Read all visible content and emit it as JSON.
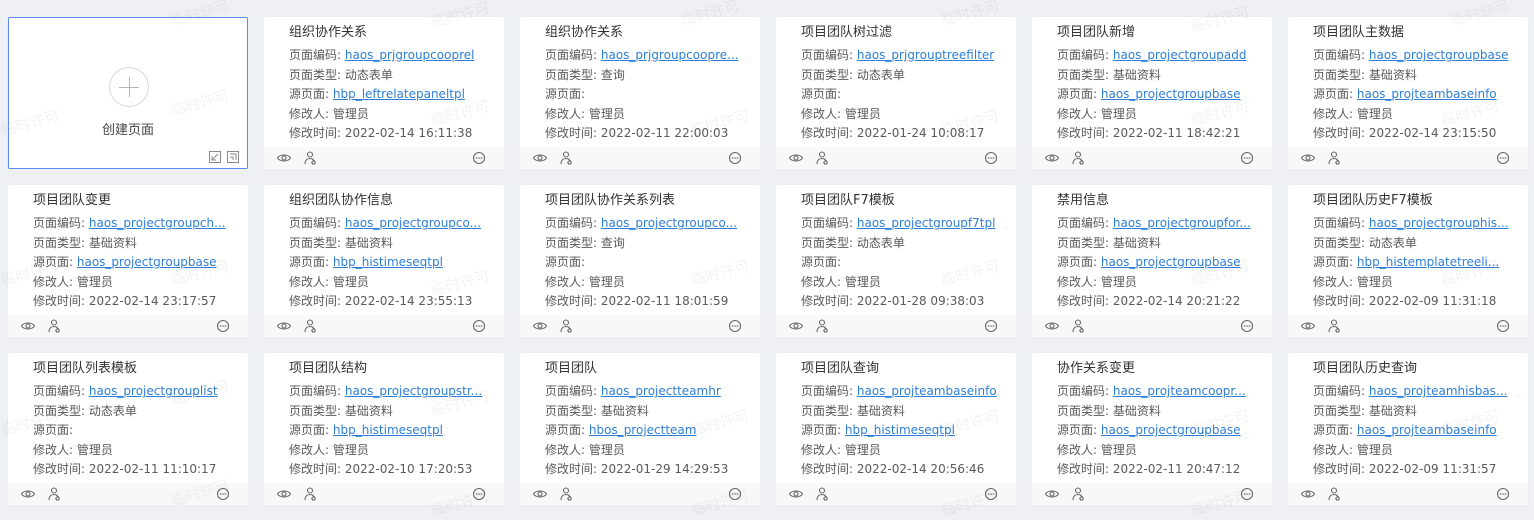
{
  "create_card": {
    "label": "创建页面"
  },
  "field_labels": {
    "code": "页面编码:",
    "type": "页面类型:",
    "source": "源页面:",
    "modifier": "修改人:",
    "time": "修改时间:"
  },
  "watermark": "临时许可",
  "cards": [
    {
      "title": "组织协作关系",
      "code": "haos_prjgroupcooprel",
      "type": "动态表单",
      "source": "hbp_leftrelatepaneltpl",
      "modifier": "管理员",
      "time": "2022-02-14 16:11:38"
    },
    {
      "title": "组织协作关系",
      "code": "haos_prjgroupcoopre...",
      "type": "查询",
      "source": "",
      "modifier": "管理员",
      "time": "2022-02-11 22:00:03"
    },
    {
      "title": "项目团队树过滤",
      "code": "haos_prjgrouptreefilter",
      "type": "动态表单",
      "source": "",
      "modifier": "管理员",
      "time": "2022-01-24 10:08:17"
    },
    {
      "title": "项目团队新增",
      "code": "haos_projectgroupadd",
      "type": "基础资料",
      "source": "haos_projectgroupbase",
      "modifier": "管理员",
      "time": "2022-02-11 18:42:21"
    },
    {
      "title": "项目团队主数据",
      "code": "haos_projectgroupbase",
      "type": "基础资料",
      "source": "haos_projteambaseinfo",
      "modifier": "管理员",
      "time": "2022-02-14 23:15:50"
    },
    {
      "title": "项目团队变更",
      "code": "haos_projectgroupch...",
      "type": "基础资料",
      "source": "haos_projectgroupbase",
      "modifier": "管理员",
      "time": "2022-02-14 23:17:57"
    },
    {
      "title": "组织团队协作信息",
      "code": "haos_projectgroupco...",
      "type": "基础资料",
      "source": "hbp_histimeseqtpl",
      "modifier": "管理员",
      "time": "2022-02-14 23:55:13"
    },
    {
      "title": "项目团队协作关系列表",
      "code": "haos_projectgroupco...",
      "type": "查询",
      "source": "",
      "modifier": "管理员",
      "time": "2022-02-11 18:01:59"
    },
    {
      "title": "项目团队F7模板",
      "code": "haos_projectgroupf7tpl",
      "type": "动态表单",
      "source": "",
      "modifier": "管理员",
      "time": "2022-01-28 09:38:03"
    },
    {
      "title": "禁用信息",
      "code": "haos_projectgroupfor...",
      "type": "基础资料",
      "source": "haos_projectgroupbase",
      "modifier": "管理员",
      "time": "2022-02-14 20:21:22"
    },
    {
      "title": "项目团队历史F7模板",
      "code": "haos_projectgrouphis...",
      "type": "动态表单",
      "source": "hbp_histemplatetreeli...",
      "modifier": "管理员",
      "time": "2022-02-09 11:31:18"
    },
    {
      "title": "项目团队列表模板",
      "code": "haos_projectgrouplist",
      "type": "动态表单",
      "source": "",
      "modifier": "管理员",
      "time": "2022-02-11 11:10:17"
    },
    {
      "title": "项目团队结构",
      "code": "haos_projectgroupstr...",
      "type": "基础资料",
      "source": "hbp_histimeseqtpl",
      "modifier": "管理员",
      "time": "2022-02-10 17:20:53"
    },
    {
      "title": "项目团队",
      "code": "haos_projectteamhr",
      "type": "基础资料",
      "source": "hbos_projectteam",
      "modifier": "管理员",
      "time": "2022-01-29 14:29:53"
    },
    {
      "title": "项目团队查询",
      "code": "haos_projteambaseinfo",
      "type": "基础资料",
      "source": "hbp_histimeseqtpl",
      "modifier": "管理员",
      "time": "2022-02-14 20:56:46"
    },
    {
      "title": "协作关系变更",
      "code": "haos_projteamcoopr...",
      "type": "基础资料",
      "source": "haos_projectgroupbase",
      "modifier": "管理员",
      "time": "2022-02-11 20:47:12"
    },
    {
      "title": "项目团队历史查询",
      "code": "haos_projteamhisbas...",
      "type": "基础资料",
      "source": "haos_projteambaseinfo",
      "modifier": "管理员",
      "time": "2022-02-09 11:31:57"
    }
  ],
  "icons": {
    "preview": "eye-icon",
    "share": "share-icon",
    "more": "more-icon",
    "import": "import-icon",
    "expand": "expand-icon"
  }
}
